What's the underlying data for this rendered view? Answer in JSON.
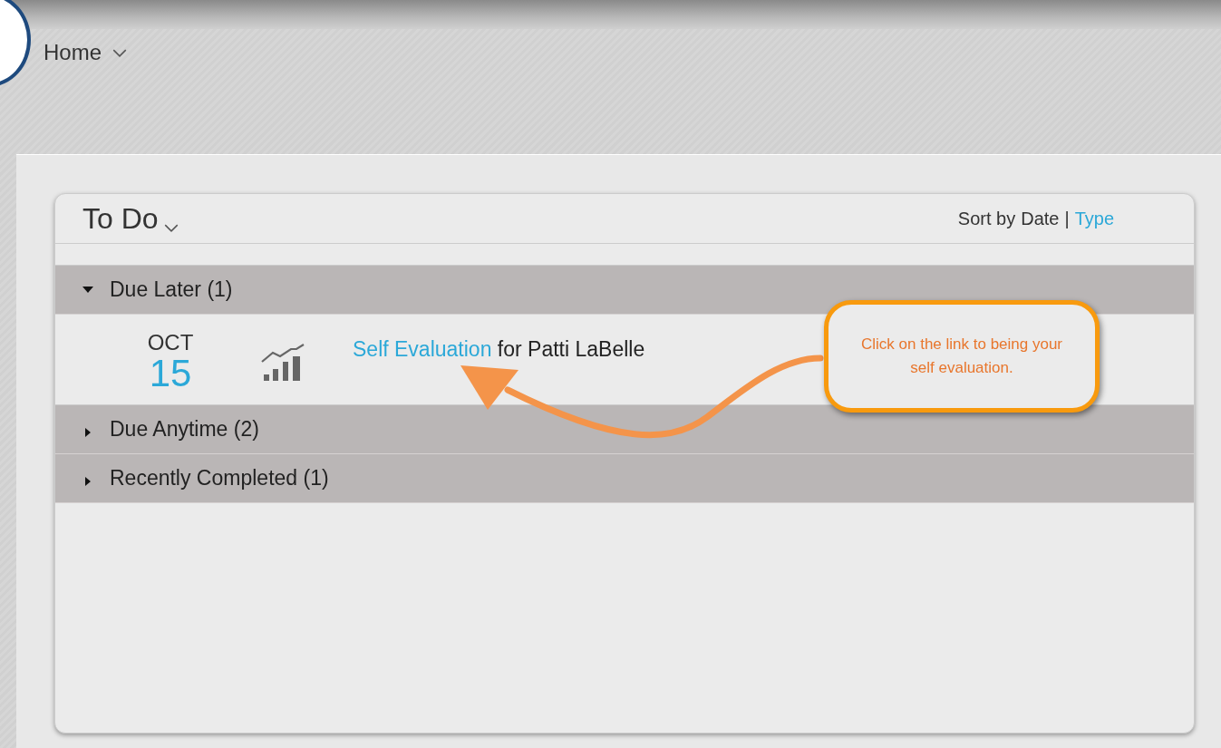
{
  "nav": {
    "label": "Home"
  },
  "card": {
    "title": "To Do",
    "sort": {
      "label": "Sort by",
      "separator": "|",
      "options": [
        {
          "label": "Date",
          "selected": true
        },
        {
          "label": "Type",
          "selected": false
        }
      ]
    },
    "sections": [
      {
        "title": "Due Later (1)",
        "expanded": true,
        "items": [
          {
            "month": "OCT",
            "day": "15",
            "link": "Self Evaluation",
            "text": "for Patti LaBelle"
          }
        ]
      },
      {
        "title": "Due Anytime (2)",
        "expanded": false
      },
      {
        "title": "Recently Completed (1)",
        "expanded": false
      }
    ]
  },
  "callout": {
    "text": "Click on the link to being your self evaluation."
  }
}
